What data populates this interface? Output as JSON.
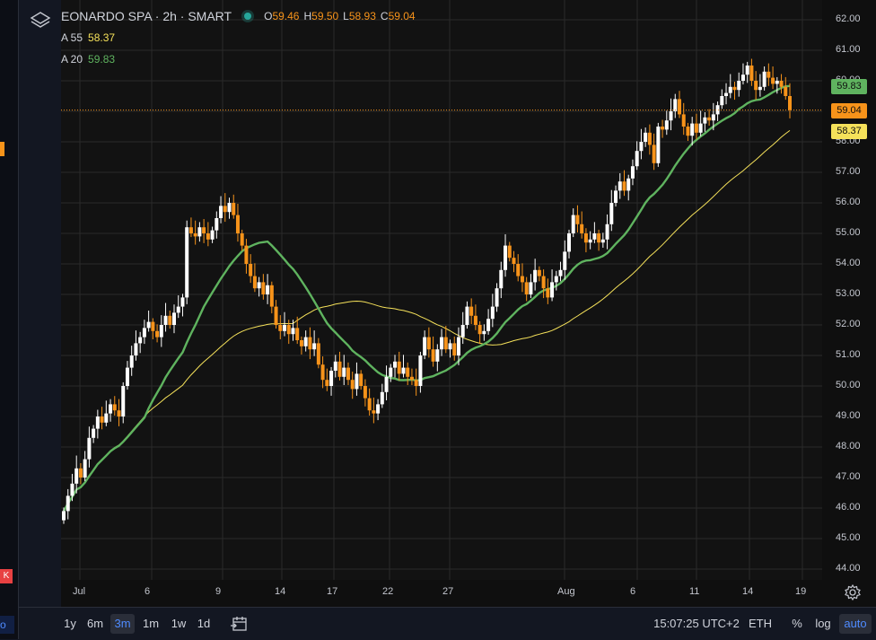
{
  "header": {
    "symbol": "EONARDO SPA · 2h · SMART",
    "ohlc": {
      "open": "59.46",
      "high": "59.50",
      "low": "58.93",
      "close": "59.04"
    },
    "ma55_label": "A 55",
    "ma55_value": "58.37",
    "ma20_label": "A 20",
    "ma20_value": "59.83"
  },
  "bottom_bar": {
    "ranges": [
      "1y",
      "6m",
      "3m",
      "1m",
      "1w",
      "1d"
    ],
    "active_range": "3m",
    "clock": "15:07:25 UTC+2",
    "session": "ETH",
    "percent": "%",
    "log": "log",
    "auto": "auto"
  },
  "left_toolbar": {
    "k_label": "K",
    "o_label": "o"
  },
  "colors": {
    "up_candle": "#ffffff",
    "down_candle": "#f7931a",
    "ma20_line": "#5fb35f",
    "ma55_line": "#f5e15a",
    "last_price_tag": "#f7931a",
    "background": "#121212"
  },
  "chart_data": {
    "type": "candlestick",
    "interval": "2h",
    "y_axis": {
      "ticks": [
        "62.00",
        "61.00",
        "60.00",
        "59.00",
        "58.00",
        "57.00",
        "56.00",
        "55.00",
        "54.00",
        "53.00",
        "52.00",
        "51.00",
        "50.00",
        "49.00",
        "48.00",
        "47.00",
        "46.00",
        "45.00",
        "44.00"
      ],
      "ylim": [
        43.6,
        62.4
      ],
      "price_tags": {
        "ma20": "59.83",
        "last": "59.04",
        "ma55": "58.37"
      }
    },
    "x_axis": {
      "ticks": [
        "Jul",
        "6",
        "9",
        "14",
        "17",
        "22",
        "27",
        "Aug",
        "6",
        "11",
        "14",
        "19"
      ]
    },
    "grid": true,
    "close_series": [
      45.9,
      46.4,
      46.8,
      47.3,
      47.0,
      47.6,
      48.3,
      48.6,
      49.0,
      48.8,
      49.1,
      49.4,
      49.2,
      49.0,
      50.0,
      50.6,
      51.0,
      51.4,
      51.6,
      51.9,
      52.1,
      51.8,
      51.6,
      52.0,
      52.3,
      52.0,
      52.4,
      52.6,
      52.9,
      55.2,
      55.0,
      54.9,
      55.2,
      55.0,
      54.8,
      55.1,
      55.5,
      55.9,
      55.7,
      56.0,
      55.6,
      55.0,
      54.6,
      54.0,
      53.6,
      53.2,
      53.4,
      53.0,
      53.3,
      52.6,
      52.0,
      51.8,
      52.0,
      51.7,
      51.9,
      51.5,
      51.3,
      51.6,
      51.2,
      51.4,
      50.7,
      50.2,
      50.0,
      50.5,
      50.8,
      50.3,
      50.6,
      50.2,
      49.9,
      50.4,
      50.0,
      49.6,
      49.2,
      49.1,
      49.4,
      49.8,
      50.3,
      50.6,
      50.8,
      50.4,
      50.6,
      50.3,
      50.2,
      50.0,
      51.0,
      51.6,
      51.2,
      50.8,
      51.2,
      51.6,
      51.2,
      51.4,
      51.0,
      51.6,
      52.0,
      52.6,
      52.3,
      52.0,
      51.7,
      51.8,
      52.2,
      52.6,
      53.2,
      53.8,
      54.6,
      54.2,
      54.0,
      53.6,
      53.4,
      53.0,
      53.4,
      53.8,
      53.6,
      53.2,
      52.9,
      53.4,
      53.6,
      53.8,
      54.4,
      55.0,
      55.6,
      55.3,
      55.0,
      54.7,
      54.8,
      55.0,
      54.7,
      54.8,
      55.3,
      56.0,
      56.4,
      56.7,
      56.4,
      56.8,
      57.2,
      57.7,
      58.0,
      58.3,
      57.9,
      57.3,
      58.5,
      58.4,
      58.7,
      59.0,
      59.4,
      58.9,
      58.5,
      58.2,
      58.6,
      58.3,
      58.6,
      58.8,
      58.7,
      58.9,
      59.2,
      59.5,
      59.6,
      59.8,
      59.7,
      60.0,
      60.2,
      60.5,
      60.0,
      59.7,
      59.8,
      60.3,
      60.1,
      59.9,
      60.0,
      59.8,
      59.5,
      59.04
    ],
    "series": [
      {
        "name": "A 20",
        "values_last": 59.83
      },
      {
        "name": "A 55",
        "values_last": 58.37
      }
    ]
  }
}
